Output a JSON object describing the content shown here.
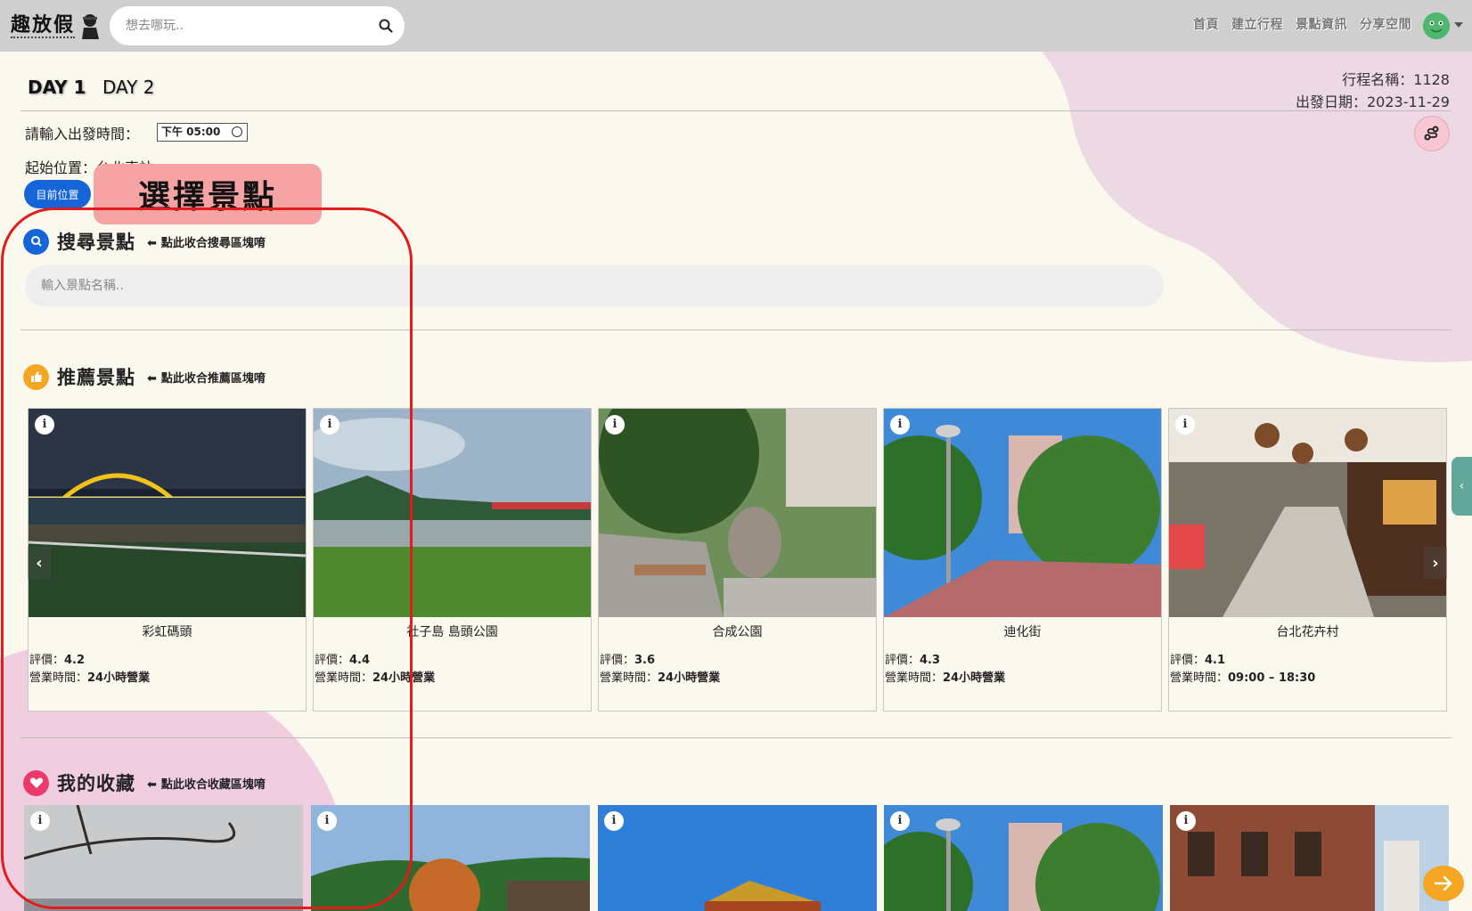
{
  "brand": {
    "logo_text": "趣放假"
  },
  "header": {
    "search_placeholder": "想去哪玩..",
    "nav": [
      "首頁",
      "建立行程",
      "景點資訊",
      "分享空間"
    ]
  },
  "days": [
    "DAY 1",
    "DAY 2"
  ],
  "trip": {
    "name_label": "行程名稱：1128",
    "date_label": "出發日期：2023-11-29"
  },
  "depart": {
    "label": "請輸入出發時間：",
    "value": "下午 05:00"
  },
  "start": {
    "label": "起始位置：台北車站",
    "current_button": "目前位置"
  },
  "callout": "選擇景點",
  "search_section": {
    "title": "搜尋景點",
    "hint": "點此收合搜尋區塊唷",
    "placeholder": "輸入景點名稱.."
  },
  "recommend_section": {
    "title": "推薦景點",
    "hint": "點此收合推薦區塊唷",
    "cards": [
      {
        "name": "彩虹碼頭",
        "rating_label": "評價：",
        "rating": "4.2",
        "hours_label": "營業時間：",
        "hours": "24小時營業"
      },
      {
        "name": "社子島 島頭公園",
        "rating_label": "評價：",
        "rating": "4.4",
        "hours_label": "營業時間：",
        "hours": "24小時營業"
      },
      {
        "name": "合成公園",
        "rating_label": "評價：",
        "rating": "3.6",
        "hours_label": "營業時間：",
        "hours": "24小時營業"
      },
      {
        "name": "迪化街",
        "rating_label": "評價：",
        "rating": "4.3",
        "hours_label": "營業時間：",
        "hours": "24小時營業"
      },
      {
        "name": "台北花卉村",
        "rating_label": "評價：",
        "rating": "4.1",
        "hours_label": "營業時間：",
        "hours": "09:00 – 18:30"
      }
    ]
  },
  "favorites_section": {
    "title": "我的收藏",
    "hint": "點此收合收藏區塊唷"
  },
  "icons": {
    "search": "search-icon",
    "info": "info-icon",
    "prev": "chevron-left-icon",
    "next": "chevron-right-icon",
    "route": "route-icon",
    "next_step": "arrow-right-icon"
  },
  "colors": {
    "navbar": "#cfcfcf",
    "background": "#fbf8ee",
    "accent_blue": "#1565d8",
    "callout": "#f6a3a3",
    "outline": "#e21b1b",
    "next": "#f5a623"
  }
}
